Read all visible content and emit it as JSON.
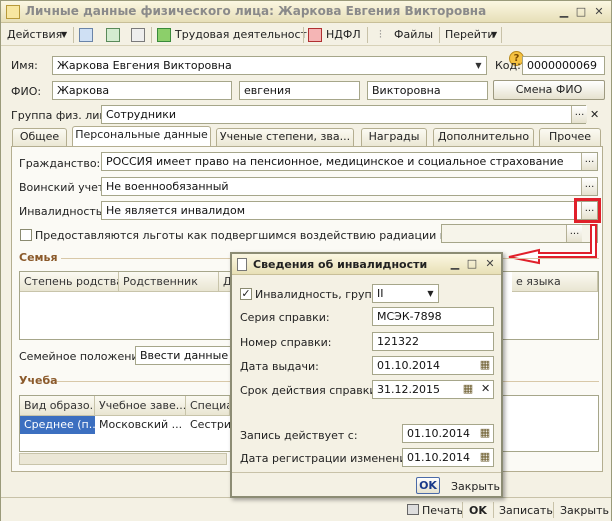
{
  "window": {
    "title": "Личные данные физического лица: Жаркова Евгения Викторовна"
  },
  "toolbar": {
    "actions": "Действия",
    "labor": "Трудовая деятельность",
    "ndfl": "НДФЛ",
    "files": "Файлы",
    "goto": "Перейти"
  },
  "form": {
    "name_label": "Имя:",
    "name_value": "Жаркова Евгения Викторовна",
    "code_label": "Код:",
    "code_value": "0000000069",
    "fio_label": "ФИО:",
    "last_name": "Жаркова",
    "first_name": "евгения",
    "middle_name": "Викторовна",
    "change_fio": "Смена ФИО",
    "group_label": "Группа физ. лиц:",
    "group_value": "Сотрудники"
  },
  "tabs": [
    "Общее",
    "Персональные данные",
    "Ученые степени, зва...",
    "Награды",
    "Дополнительно",
    "Прочее"
  ],
  "personal": {
    "citizenship_label": "Гражданство:",
    "citizenship_value": "РОССИЯ имеет право на пенсионное, медицинское и социальное страхование",
    "military_label": "Воинский учет:",
    "military_value": "Не военнообязанный",
    "disability_label": "Инвалидность:",
    "disability_value": "Не является инвалидом",
    "benefits_label": "Предоставляются льготы как подвергшимся воздействию радиации в связи с:",
    "family_section": "Семья",
    "family_cols": [
      "Степень родства",
      "Родственник",
      "Д",
      "е языка"
    ],
    "marital_label": "Семейное положение:",
    "marital_value": "Ввести данные о",
    "study_section": "Учеба",
    "study_cols": [
      "Вид образо...",
      "Учебное заве...",
      "Специа"
    ],
    "study_row": [
      "Среднее (п...",
      "Московский ...",
      "Сестри"
    ]
  },
  "dialog": {
    "title": "Сведения об инвалидности",
    "group_label": "Инвалидность, группа:",
    "group_value": "II",
    "series_label": "Серия справки:",
    "series_value": "МСЭК-7898",
    "number_label": "Номер справки:",
    "number_value": "121322",
    "issue_label": "Дата выдачи:",
    "issue_value": "01.10.2014",
    "validity_label": "Срок действия справки:",
    "validity_value": "31.12.2015",
    "effective_label": "Запись действует с:",
    "effective_value": "01.10.2014",
    "reg_label": "Дата регистрации изменений:",
    "reg_value": "01.10.2014",
    "ok": "OK",
    "close": "Закрыть"
  },
  "bottom": {
    "print": "Печать",
    "ok": "OK",
    "save": "Записать",
    "close": "Закрыть"
  },
  "colors": {
    "highlight_arrow": "#e0202a",
    "selected_row": "#3c6fc0",
    "section_text": "#8b5a2b"
  }
}
